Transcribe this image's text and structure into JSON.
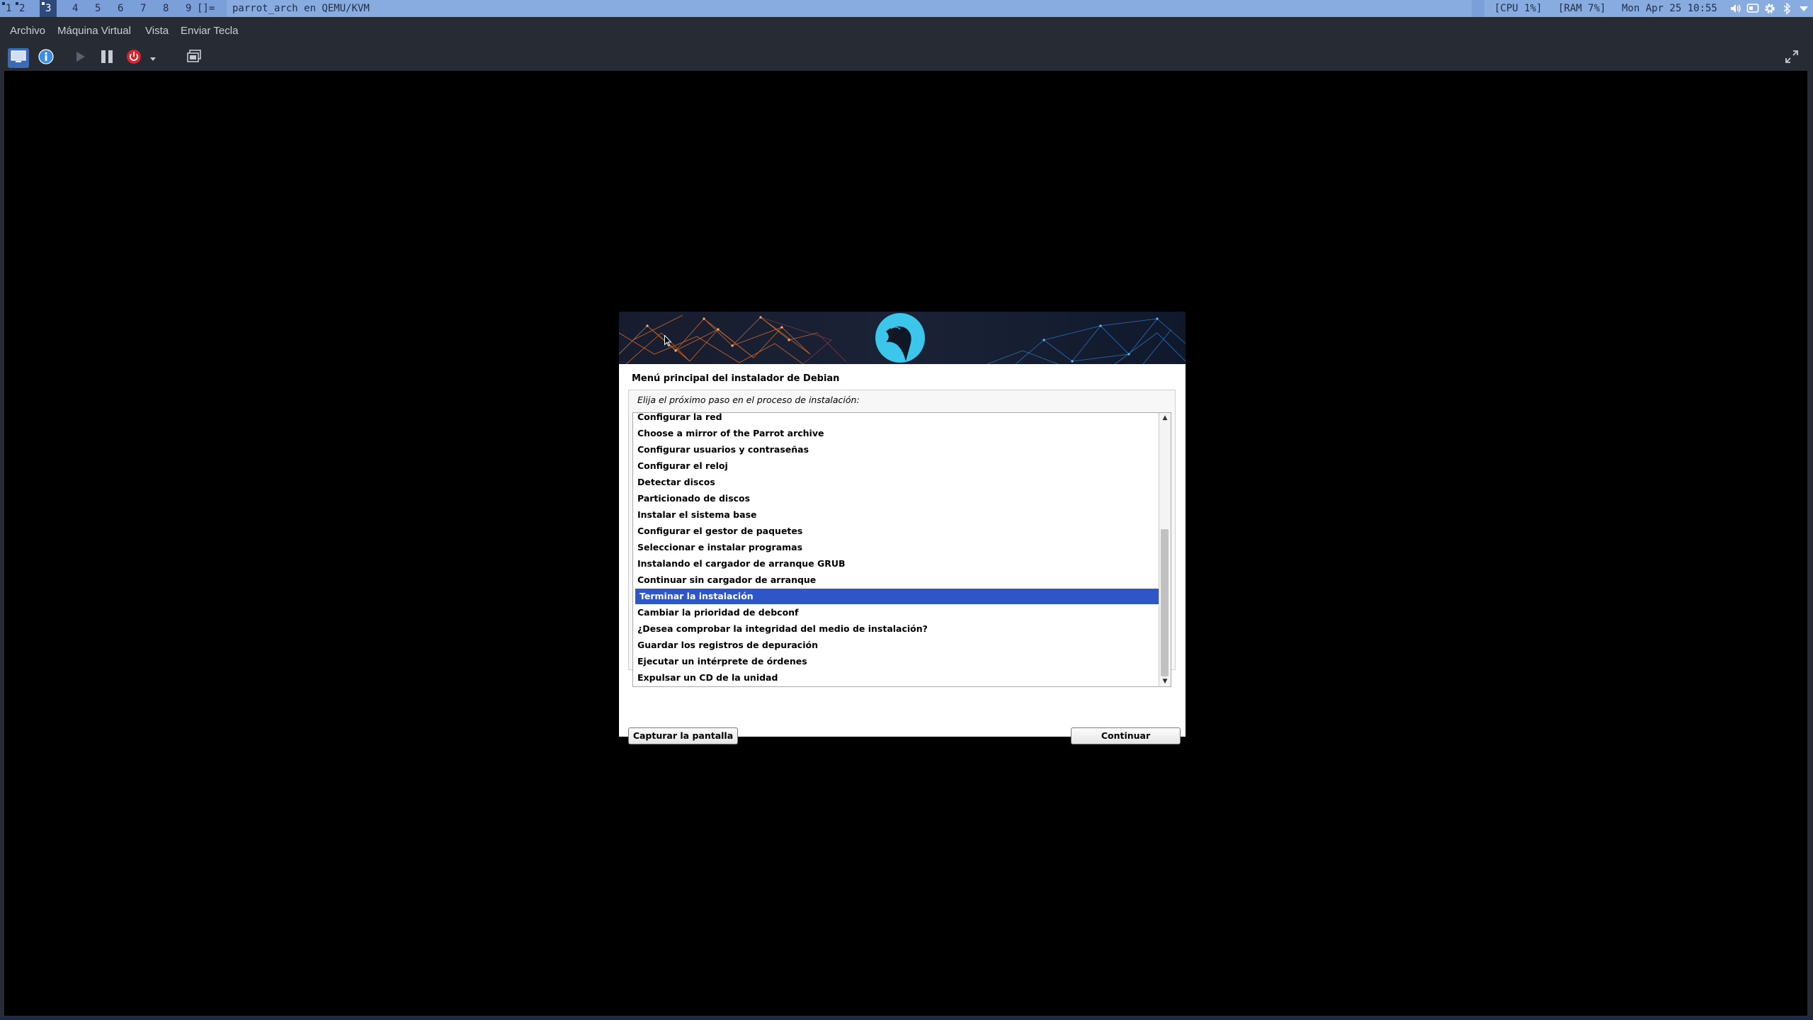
{
  "topbar": {
    "workspaces": [
      {
        "label": "1",
        "active": false,
        "dot": true
      },
      {
        "label": "2",
        "active": false,
        "dot": true
      },
      {
        "label": "3",
        "active": true,
        "dot": true
      },
      {
        "label": "4",
        "active": false,
        "dot": false
      },
      {
        "label": "5",
        "active": false,
        "dot": false
      },
      {
        "label": "6",
        "active": false,
        "dot": false
      },
      {
        "label": "7",
        "active": false,
        "dot": false
      },
      {
        "label": "8",
        "active": false,
        "dot": false
      },
      {
        "label": "9",
        "active": false,
        "dot": false
      }
    ],
    "layout_symbol": "[]=",
    "window_title": "parrot_arch en QEMU/KVM",
    "cpu": "[CPU 1%]",
    "ram": "[RAM 7%]",
    "datetime": "Mon Apr 25 10:55",
    "tray_icons": [
      "volume-icon",
      "display-icon",
      "settings-gear-icon",
      "bluetooth-icon",
      "dropdown-arrow-icon"
    ]
  },
  "vm_window": {
    "menu": {
      "archivo": "Archivo",
      "maquina_virtual": "Máquina Virtual",
      "vista": "Vista",
      "enviar_tecla": "Enviar Tecla"
    },
    "toolbar_icons": [
      "console-view-icon",
      "details-info-icon",
      "run-play-icon",
      "pause-icon",
      "power-off-icon",
      "dropdown-arrow-icon",
      "snapshots-icon",
      "fullscreen-icon"
    ]
  },
  "installer": {
    "title": "Menú principal del instalador de Debian",
    "prompt": "Elija el próximo paso en el proceso de instalación:",
    "items": [
      "Configurar la red",
      "Choose a mirror of the Parrot archive",
      "Configurar usuarios y contraseñas",
      "Configurar el reloj",
      "Detectar discos",
      "Particionado de discos",
      "Instalar el sistema base",
      "Configurar el gestor de paquetes",
      "Seleccionar e instalar programas",
      "Instalando el cargador de arranque GRUB",
      "Continuar sin cargador de arranque",
      "Terminar la instalación",
      "Cambiar la prioridad de debconf",
      "¿Desea comprobar la integridad del medio de instalación?",
      "Guardar los registros de depuración",
      "Ejecutar un intérprete de órdenes",
      "Expulsar un CD de la unidad"
    ],
    "selected_index": 11,
    "scroll_position": 0.42,
    "scroll_visible_fraction": 0.58,
    "screenshot_button": "Capturar la pantalla",
    "continue_button": "Continuar"
  },
  "colors": {
    "topbar_bg": "#7a9fd9",
    "active_workspace": "#2d4a7a",
    "selection": "#2f56c9",
    "logo_circle": "#3cc6ec",
    "accent_orange": "#e8732c",
    "accent_blue": "#2f7fd1"
  }
}
